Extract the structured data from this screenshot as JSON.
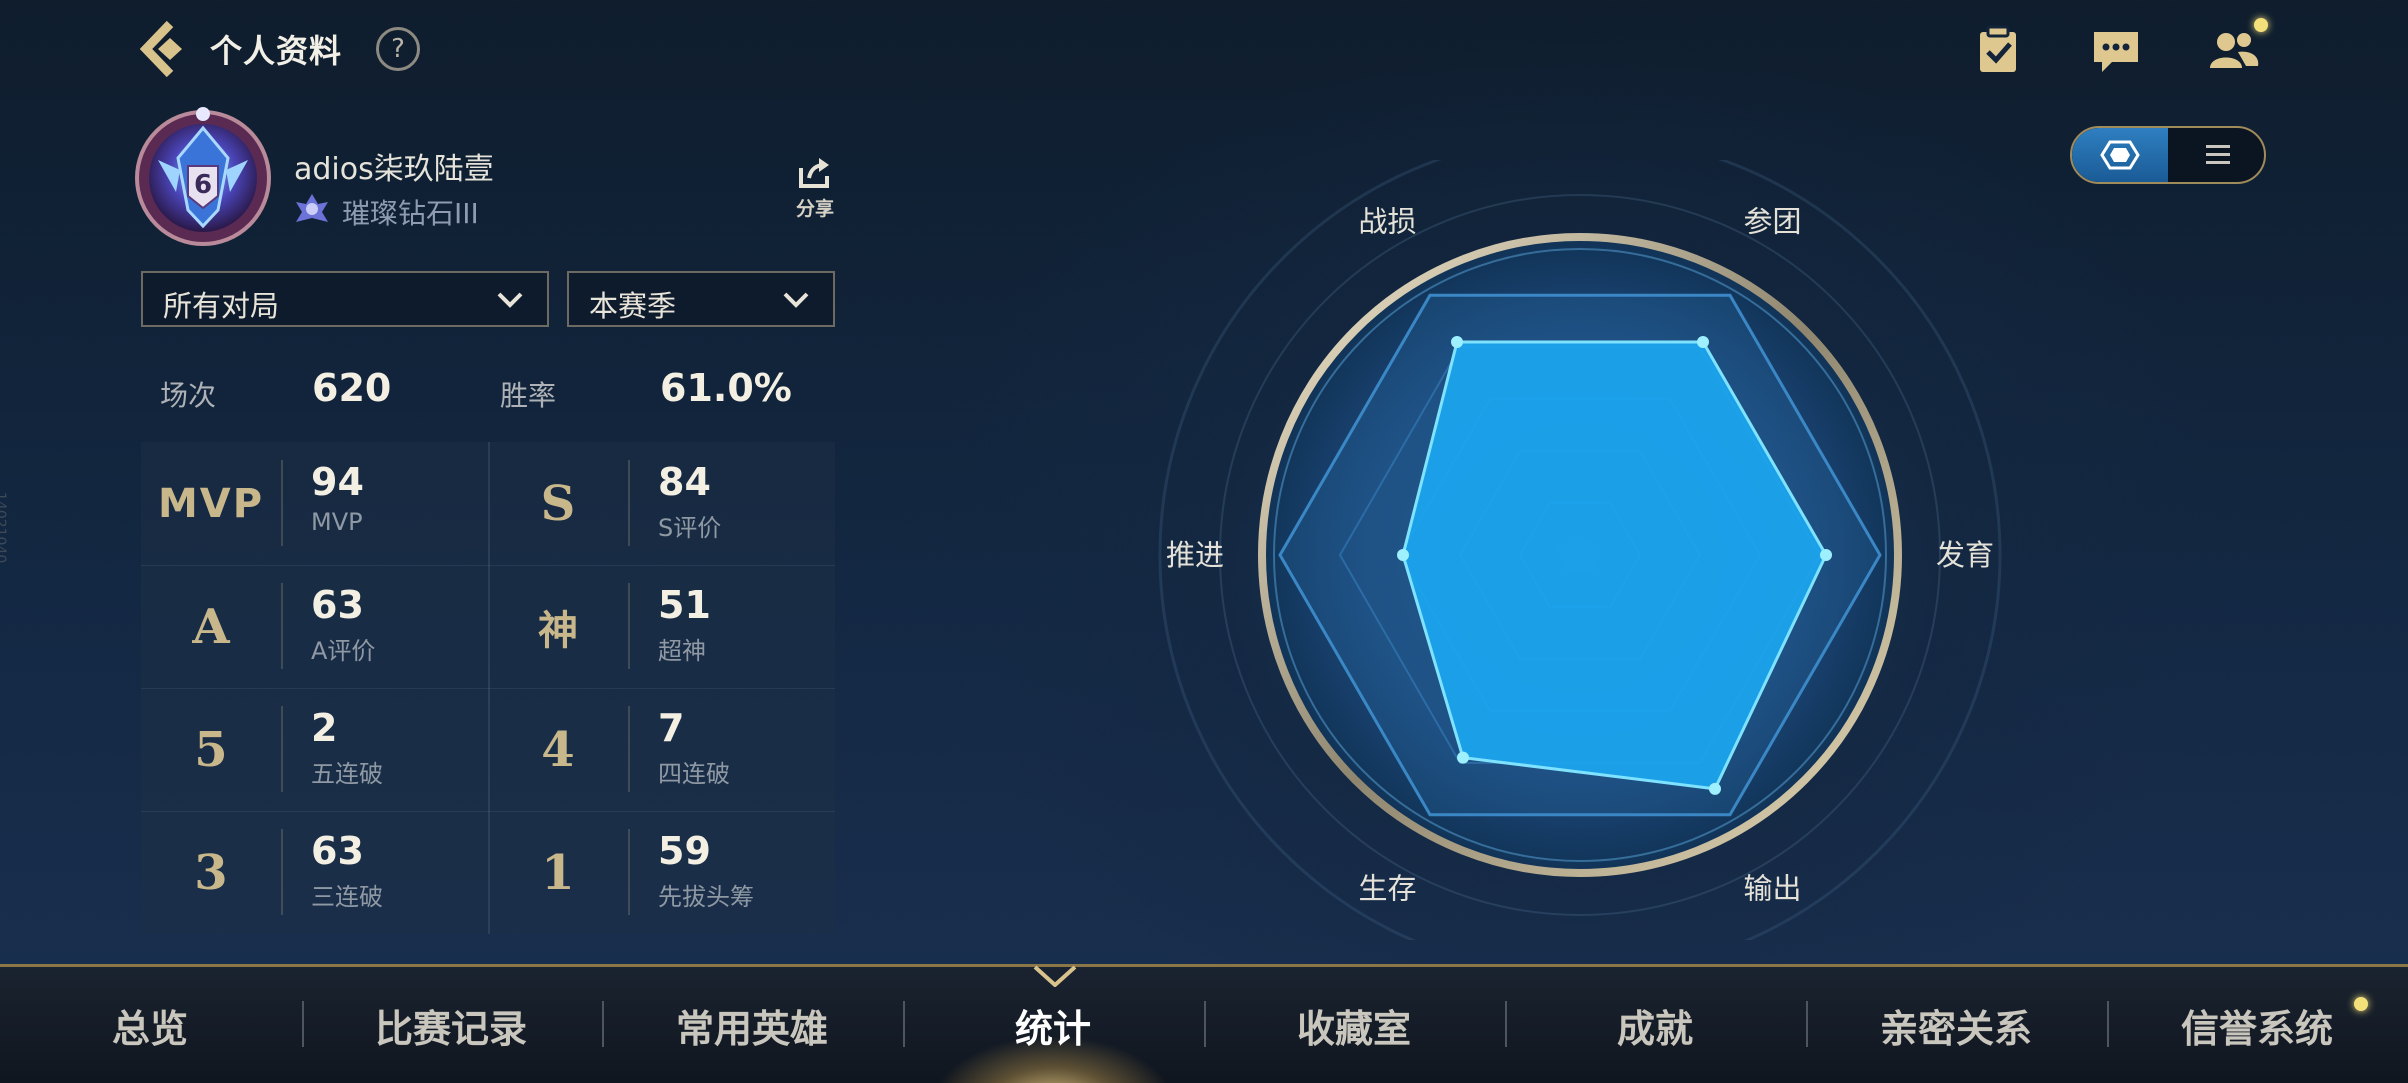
{
  "header": {
    "title": "个人资料",
    "help_symbol": "?"
  },
  "profile": {
    "username": "adios柒玖陆壹",
    "rank": "璀璨钻石III",
    "avatar_badge": "6",
    "share_label": "分享"
  },
  "filters": {
    "mode": {
      "selected": "所有对局"
    },
    "season": {
      "selected": "本赛季"
    }
  },
  "summary": {
    "games_label": "场次",
    "games_value": "620",
    "winrate_label": "胜率",
    "winrate_value": "61.0%"
  },
  "stats": [
    {
      "emblem": "MVP",
      "value": "94",
      "label": "MVP"
    },
    {
      "emblem": "S",
      "value": "84",
      "label": "S评价"
    },
    {
      "emblem": "A",
      "value": "63",
      "label": "A评价"
    },
    {
      "emblem": "神",
      "value": "51",
      "label": "超神"
    },
    {
      "emblem": "5",
      "value": "2",
      "label": "五连破"
    },
    {
      "emblem": "4",
      "value": "7",
      "label": "四连破"
    },
    {
      "emblem": "3",
      "value": "63",
      "label": "三连破"
    },
    {
      "emblem": "1",
      "value": "59",
      "label": "先拔头筹"
    }
  ],
  "radar": {
    "axes": [
      "战损",
      "参团",
      "发育",
      "输出",
      "生存",
      "推进"
    ],
    "values": [
      0.82,
      0.82,
      0.82,
      0.9,
      0.78,
      0.59
    ],
    "fill_color": "#1ba6f0",
    "stroke_color": "#7fe3ff"
  },
  "view_toggle": {
    "options": [
      "radar-icon",
      "list-icon"
    ],
    "active": "radar-icon"
  },
  "nav": {
    "items": [
      "总览",
      "比赛记录",
      "常用英雄",
      "统计",
      "收藏室",
      "成就",
      "亲密关系",
      "信誉系统"
    ],
    "active_index": 3
  },
  "side_text": "14021040"
}
